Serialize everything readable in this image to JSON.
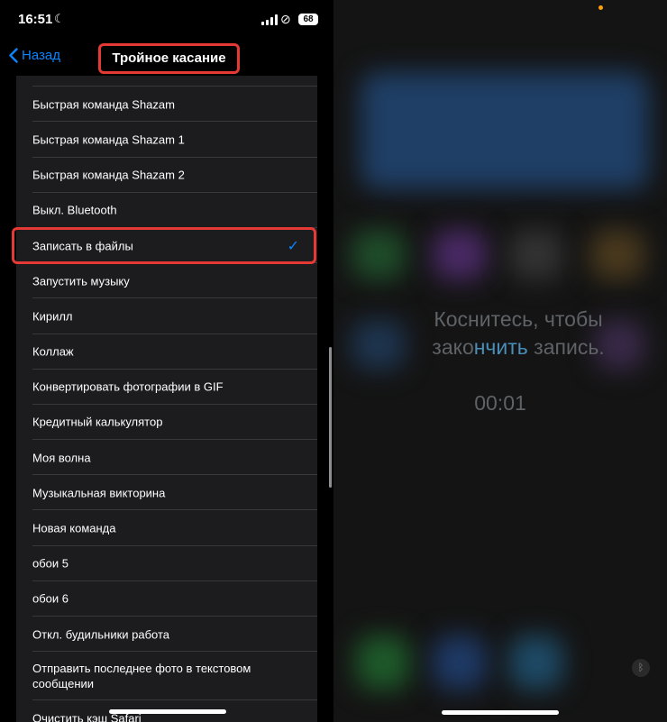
{
  "status": {
    "time": "16:51",
    "battery": "68"
  },
  "nav": {
    "back_label": "Назад",
    "title": "Тройное касание"
  },
  "list": {
    "items": [
      {
        "label": "",
        "checked": false
      },
      {
        "label": "Быстрая команда Shazam",
        "checked": false
      },
      {
        "label": "Быстрая команда Shazam 1",
        "checked": false
      },
      {
        "label": "Быстрая команда Shazam 2",
        "checked": false
      },
      {
        "label": "Выкл. Bluetooth",
        "checked": false
      },
      {
        "label": "Записать в файлы",
        "checked": true
      },
      {
        "label": "Запустить музыку",
        "checked": false
      },
      {
        "label": "Кирилл",
        "checked": false
      },
      {
        "label": "Коллаж",
        "checked": false
      },
      {
        "label": "Конвертировать фотографии в GIF",
        "checked": false
      },
      {
        "label": "Кредитный калькулятор",
        "checked": false
      },
      {
        "label": "Моя волна",
        "checked": false
      },
      {
        "label": "Музыкальная викторина",
        "checked": false
      },
      {
        "label": "Новая команда",
        "checked": false
      },
      {
        "label": "обои 5",
        "checked": false
      },
      {
        "label": "обои 6",
        "checked": false
      },
      {
        "label": "Откл. будильники работа",
        "checked": false
      },
      {
        "label": "Отправить последнее фото в текстовом сообщении",
        "checked": false
      },
      {
        "label": "Очистить кэш Safari",
        "checked": false
      }
    ]
  },
  "recording": {
    "line1_a": "Коснитесь",
    "line1_b": ", чтобы",
    "line2_a": "зако",
    "line2_b": "нчить",
    "line2_c": " запись.",
    "timer": "00:01"
  },
  "colors": {
    "accent": "#0a84ff",
    "highlight": "#e53935"
  },
  "icons": {
    "back": "chevron-left-icon",
    "check": "checkmark-icon",
    "bluetooth": "bluetooth-icon",
    "moon": "moon-icon"
  }
}
